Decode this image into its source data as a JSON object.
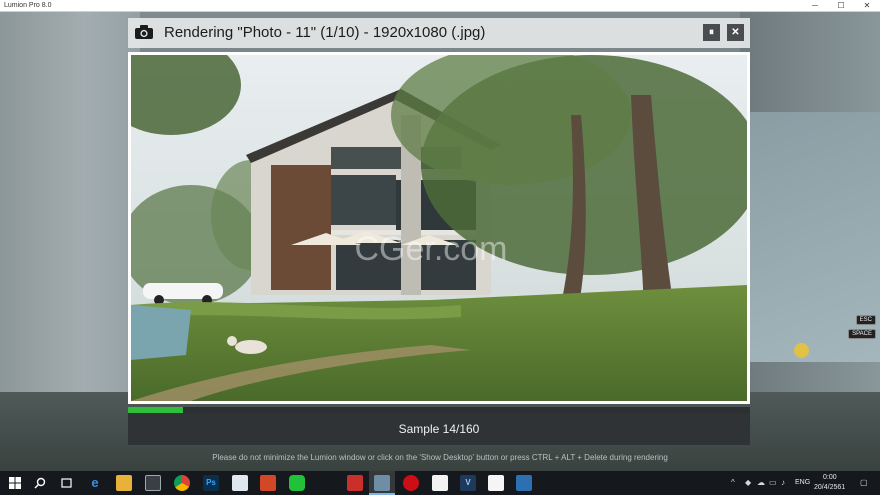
{
  "window": {
    "title": "Lumion Pro 8.0",
    "minimize_glyph": "─",
    "maximize_glyph": "☐",
    "close_glyph": "✕"
  },
  "render": {
    "title": "Rendering \"Photo - 11\" (1/10) - 1920x1080 (.jpg)",
    "pause_glyph": "⏸",
    "close_glyph": "✕",
    "watermark": "CGer.com",
    "progress": 0.088,
    "progress_color": "#2fbf3a",
    "sample_text": "Sample 14/160"
  },
  "hint": "Please do not minimize the Lumion window or click on the 'Show Desktop' button or press CTRL + ALT + Delete during rendering",
  "keys": {
    "esc": "ESC",
    "space": "SPACE"
  },
  "taskbar": {
    "icons": [
      "windows-icon",
      "search-icon",
      "task-view-icon",
      "edge-icon",
      "file-explorer-icon",
      "store-icon",
      "chrome-icon",
      "photoshop-icon",
      "notepad-icon",
      "powerpoint-icon",
      "line-icon",
      "sketchup-icon",
      "lumion-icon",
      "opera-icon",
      "file-icon",
      "vray-icon",
      "mail-icon",
      "camera-icon"
    ],
    "photoshop_label": "Ps",
    "vray_label": "V",
    "tray_lang": "ENG",
    "tray_time": "0:00",
    "tray_date": "20/4/2561"
  }
}
